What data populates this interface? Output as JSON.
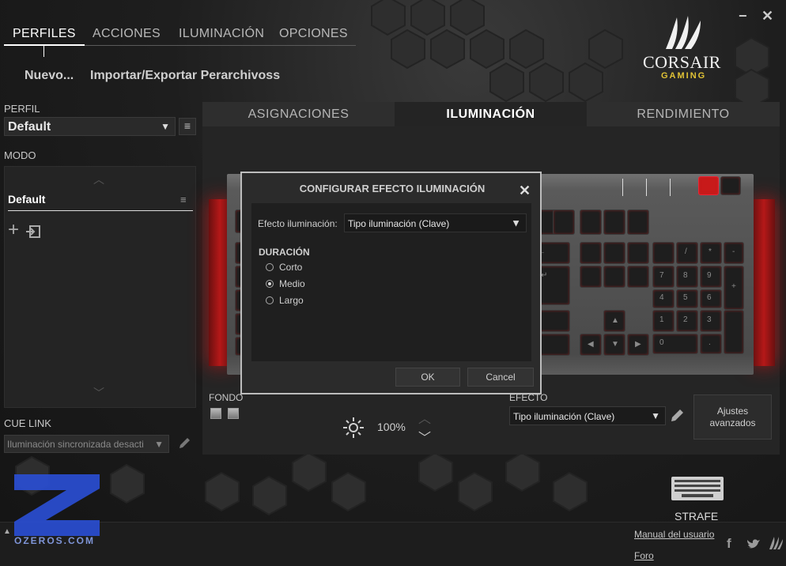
{
  "window": {
    "minimize_glyph": "−",
    "close_glyph": "✕"
  },
  "top_nav": {
    "items": [
      "PERFILES",
      "ACCIONES",
      "ILUMINACIÓN",
      "OPCIONES"
    ],
    "active": "PERFILES"
  },
  "sub_actions": {
    "new": "Nuevo...",
    "import_export": "Importar/Exportar Perarchivoss"
  },
  "logo": {
    "brand": "CORSAIR",
    "sub": "GAMING"
  },
  "profile": {
    "label": "PERFIL",
    "value": "Default"
  },
  "mode": {
    "label": "MODO",
    "value": "Default"
  },
  "cue_link": {
    "label": "CUE LINK",
    "value": "Iluminación sincronizada desacti"
  },
  "main_tabs": [
    "ASIGNACIONES",
    "ILUMINACIÓN",
    "RENDIMIENTO"
  ],
  "active_tab": "ILUMINACIÓN",
  "modal": {
    "title": "CONFIGURAR EFECTO ILUMINACIÓN",
    "effect_label": "Efecto iluminación:",
    "effect_value": "Tipo iluminación (Clave)",
    "duration_label": "DURACIÓN",
    "options": [
      "Corto",
      "Medio",
      "Largo"
    ],
    "selected": "Medio",
    "ok_label": "OK",
    "cancel_label": "Cancel"
  },
  "fondo": {
    "label": "FONDO"
  },
  "brightness": {
    "value": "100%"
  },
  "efecto": {
    "label": "EFECTO",
    "value": "Tipo iluminación (Clave)"
  },
  "advanced": {
    "line1": "Ajustes",
    "line2": "avanzados"
  },
  "device": {
    "name": "STRAFE"
  },
  "footer": {
    "manual_link": "Manual del usuario",
    "forum_link": "Foro",
    "watermark": "OZEROS.COM"
  },
  "colors": {
    "accent_red": "#c81a1a",
    "logo_gold": "#e0c235",
    "watermark_blue": "#2a4fd6"
  }
}
